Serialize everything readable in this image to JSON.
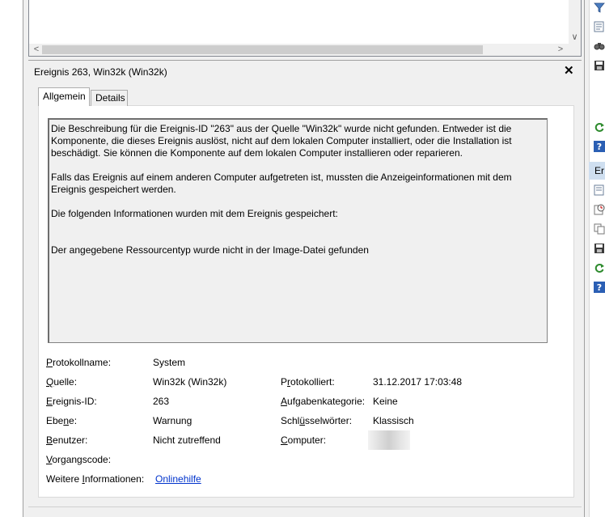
{
  "detail": {
    "title": "Ereignis 263, Win32k (Win32k)",
    "close_symbol": "✕"
  },
  "tabs": [
    {
      "label": "Allgemein",
      "active": true
    },
    {
      "label": "Details",
      "active": false
    }
  ],
  "description": {
    "p1": "Die Beschreibung für die Ereignis-ID \"263\" aus der Quelle \"Win32k\" wurde nicht gefunden. Entweder ist die Komponente, die dieses Ereignis auslöst, nicht auf dem lokalen Computer installiert, oder die Installation ist beschädigt. Sie können die Komponente auf dem lokalen Computer installieren oder reparieren.",
    "p2": "Falls das Ereignis auf einem anderen Computer aufgetreten ist, mussten die Anzeigeinformationen mit dem Ereignis gespeichert werden.",
    "p3": "Die folgenden Informationen wurden mit dem Ereignis gespeichert:",
    "p4": "Der angegebene Ressourcentyp wurde nicht in der Image-Datei gefunden"
  },
  "properties": {
    "protokollname": {
      "pre": "",
      "ul": "P",
      "post": "rotokollname:",
      "value": "System"
    },
    "quelle": {
      "pre": "",
      "ul": "Q",
      "post": "uelle:",
      "value": "Win32k (Win32k)"
    },
    "ereignis_id": {
      "pre": "",
      "ul": "E",
      "post": "reignis-ID:",
      "value": "263"
    },
    "ebene": {
      "pre": "Ebe",
      "ul": "n",
      "post": "e:",
      "value": "Warnung"
    },
    "benutzer": {
      "pre": "",
      "ul": "B",
      "post": "enutzer:",
      "value": "Nicht zutreffend"
    },
    "vorgangscode": {
      "pre": "",
      "ul": "V",
      "post": "organgscode:",
      "value": ""
    },
    "weitere": {
      "pre": "Weitere ",
      "ul": "I",
      "post": "nformationen:",
      "value": "Onlinehilfe"
    },
    "protokolliert": {
      "pre": "P",
      "ul": "r",
      "post": "otokolliert:",
      "value": "31.12.2017 17:03:48"
    },
    "aufgabenkategorie": {
      "pre": "",
      "ul": "A",
      "post": "ufgabenkategorie:",
      "value": "Keine"
    },
    "schluesselwoerter": {
      "pre": "Schl",
      "ul": "ü",
      "post": "sselwörter:",
      "value": "Klassisch"
    },
    "computer": {
      "pre": "",
      "ul": "C",
      "post": "omputer:",
      "value": ""
    }
  },
  "scroll": {
    "left_arrow": "<",
    "right_arrow": ">",
    "down_arrow": "∨"
  },
  "action_pane": {
    "header": "Er",
    "icons": [
      "filter-icon",
      "properties-icon",
      "find-icon",
      "save-icon",
      "refresh-icon",
      "help-icon",
      "event-properties-icon",
      "attach-task-icon",
      "copy-icon",
      "save-events-icon",
      "refresh-icon-2",
      "help-icon-2"
    ]
  },
  "colors": {
    "link": "#0033cc",
    "panel": "#f0f0f0",
    "action_header": "#cfdff0",
    "help_blue": "#2b5fb4",
    "refresh_green": "#2e8b2e"
  }
}
